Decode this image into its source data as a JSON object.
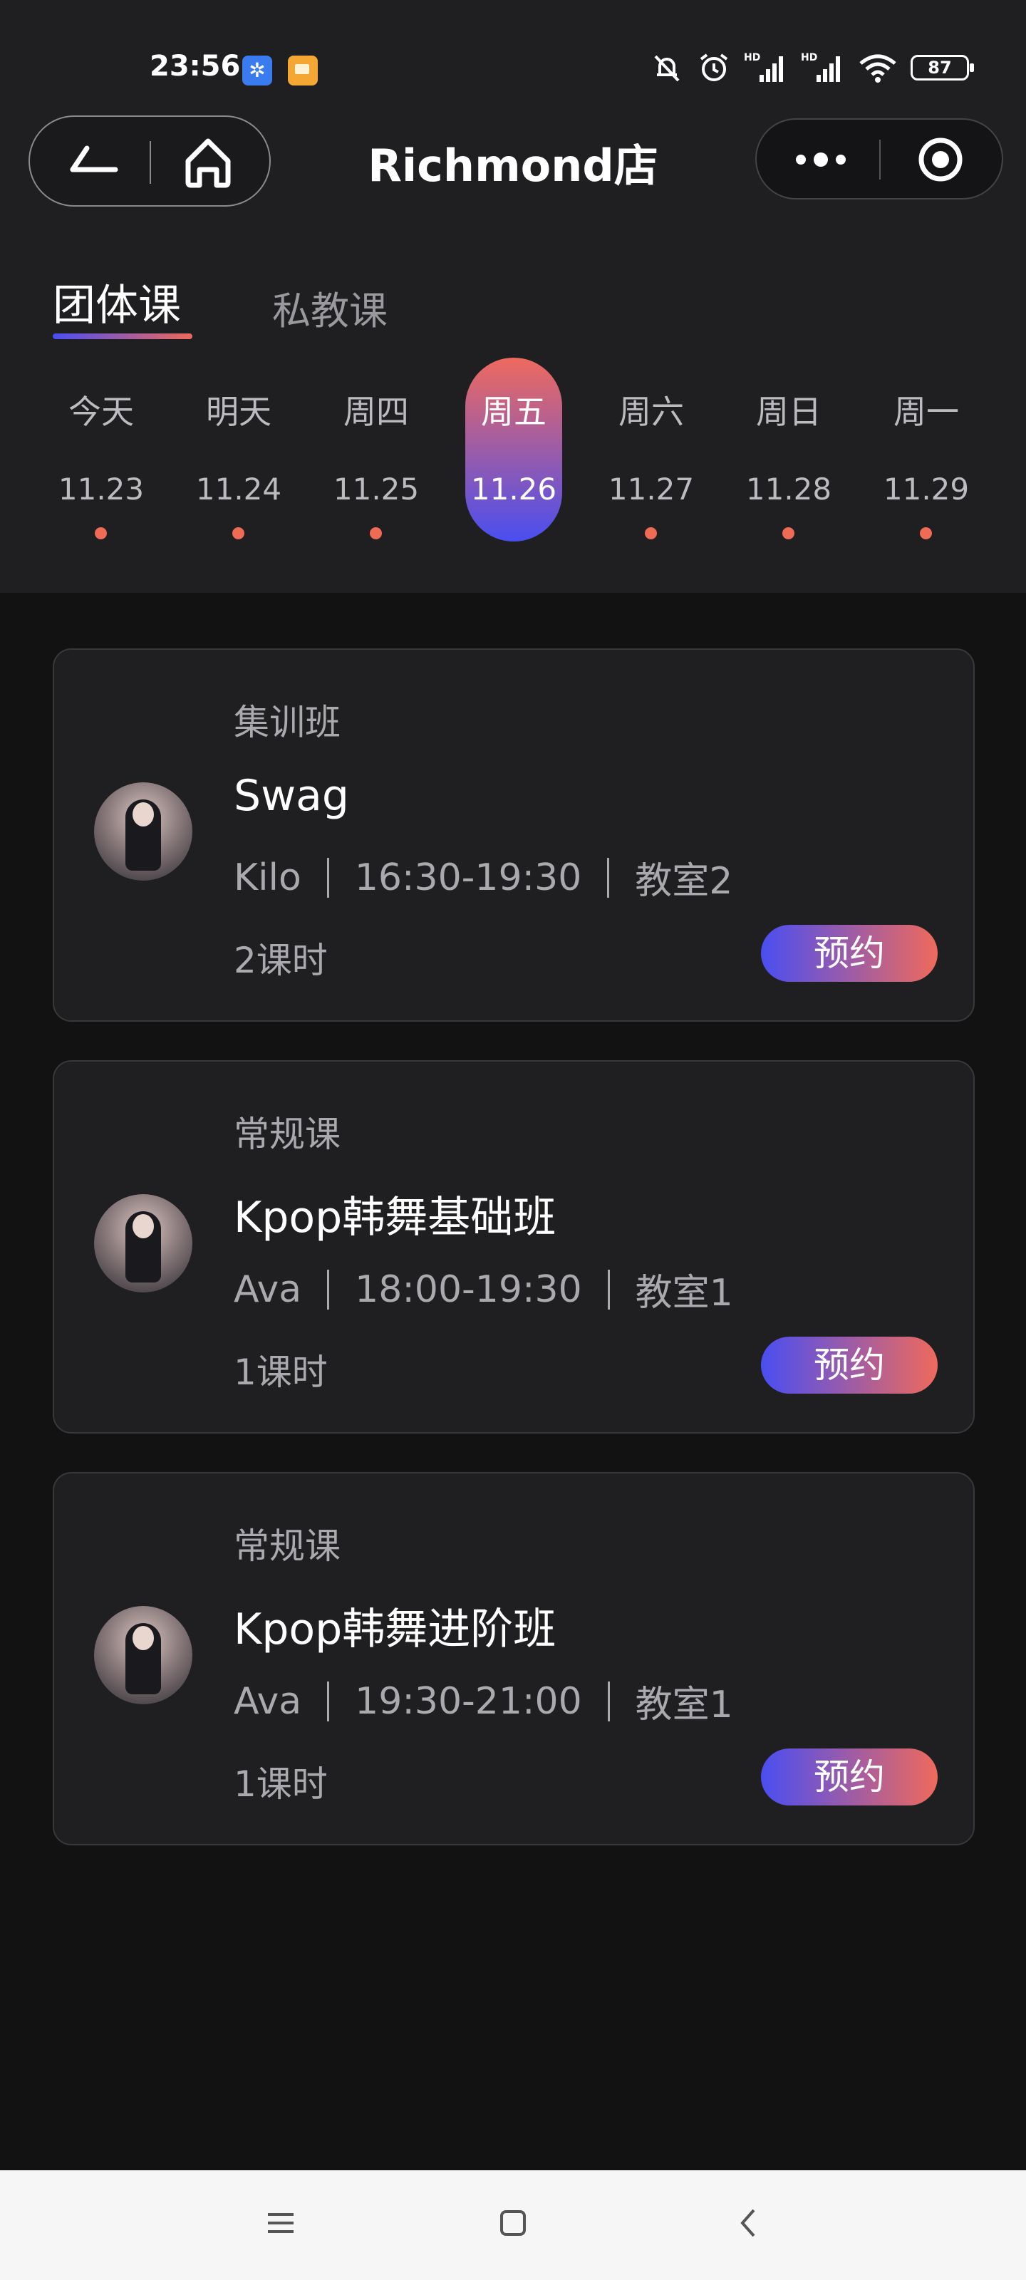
{
  "status_bar": {
    "time": "23:56",
    "battery": "87",
    "icons": [
      "app-snowflake-icon",
      "app-note-icon",
      "mute-bell-icon",
      "alarm-icon",
      "hd-signal-icon",
      "hd-signal-icon",
      "wifi-icon",
      "battery-icon"
    ]
  },
  "nav": {
    "title": "Richmond店",
    "icons": [
      "back-icon",
      "home-icon",
      "more-icon",
      "close-target-icon"
    ]
  },
  "tabs": [
    {
      "label": "团体课",
      "active": true
    },
    {
      "label": "私教课",
      "active": false
    }
  ],
  "days": [
    {
      "name": "今天",
      "date": "11.23",
      "has_class": true
    },
    {
      "name": "明天",
      "date": "11.24",
      "has_class": true
    },
    {
      "name": "周四",
      "date": "11.25",
      "has_class": true
    },
    {
      "name": "周五",
      "date": "11.26",
      "selected": true
    },
    {
      "name": "周六",
      "date": "11.27",
      "has_class": true
    },
    {
      "name": "周日",
      "date": "11.28",
      "has_class": true
    },
    {
      "name": "周一",
      "date": "11.29",
      "has_class": true
    }
  ],
  "classes": [
    {
      "type": "集训班",
      "name": "Swag",
      "teacher": "Kilo",
      "time": "16:30-19:30",
      "room": "教室2",
      "hours": "2课时",
      "button": "预约"
    },
    {
      "type": "常规课",
      "name": "Kpop韩舞基础班",
      "teacher": "Ava",
      "time": "18:00-19:30",
      "room": "教室1",
      "hours": "1课时",
      "button": "预约"
    },
    {
      "type": "常规课",
      "name": "Kpop韩舞进阶班",
      "teacher": "Ava",
      "time": "19:30-21:00",
      "room": "教室1",
      "hours": "1课时",
      "button": "预约"
    }
  ],
  "colors": {
    "accent_start": "#4a4ef2",
    "accent_end": "#ef6a5c",
    "dot": "#ef6b55",
    "background": "#121212",
    "header": "#1f1f21"
  },
  "system_nav": {
    "icons": [
      "menu-icon",
      "home-square-icon",
      "back-chevron-icon"
    ]
  }
}
